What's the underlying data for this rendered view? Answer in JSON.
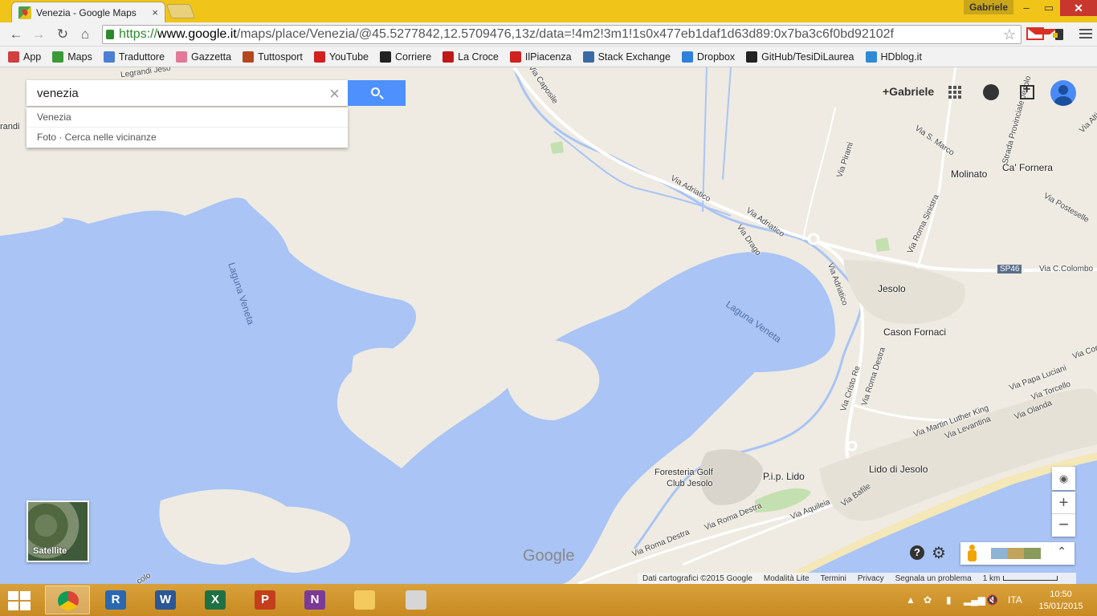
{
  "browser": {
    "tab_title": "Venezia - Google Maps",
    "tab_close": "×",
    "user": "Gabriele",
    "url": {
      "scheme": "https://",
      "host": "www.google.it",
      "path": "/maps/place/Venezia/@45.5277842,12.5709476,13z/data=!4m2!3m1!1s0x477eb1daf1d63d89:0x7ba3c6f0bd92102f"
    },
    "window_controls": {
      "minimize": "–",
      "maximize": "▭",
      "close": "✕"
    }
  },
  "bookmarks": [
    {
      "label": "App",
      "icon": "apps-grid-icon",
      "color": "#d04040"
    },
    {
      "label": "Maps",
      "icon": "maps-icon",
      "color": "#3a9a3a"
    },
    {
      "label": "Traduttore",
      "icon": "translate-icon",
      "color": "#4a7fd4"
    },
    {
      "label": "Gazzetta",
      "icon": "gazzetta-icon",
      "color": "#e2799a"
    },
    {
      "label": "Tuttosport",
      "icon": "tuttosport-icon",
      "color": "#b5471f"
    },
    {
      "label": "YouTube",
      "icon": "youtube-icon",
      "color": "#d32020"
    },
    {
      "label": "Corriere",
      "icon": "corriere-icon",
      "color": "#222222"
    },
    {
      "label": "La Croce",
      "icon": "lacroce-icon",
      "color": "#c01818"
    },
    {
      "label": "IlPiacenza",
      "icon": "ilpiacenza-icon",
      "color": "#d02020"
    },
    {
      "label": "Stack Exchange",
      "icon": "stackexchange-icon",
      "color": "#3a6aa4"
    },
    {
      "label": "Dropbox",
      "icon": "dropbox-icon",
      "color": "#2f7fdc"
    },
    {
      "label": "GitHub/TesiDiLaurea",
      "icon": "github-icon",
      "color": "#222222"
    },
    {
      "label": "HDblog.it",
      "icon": "hdblog-icon",
      "color": "#2f8ad4"
    }
  ],
  "search": {
    "query": "venezia",
    "suggestions": [
      "Venezia",
      "Foto · Cerca nelle vicinanze"
    ]
  },
  "account": {
    "name": "+Gabriele"
  },
  "map": {
    "labels": {
      "laguna1": "Laguna Veneta",
      "laguna2": "Laguna Veneta",
      "jesolo": "Jesolo",
      "molinato": "Molinato",
      "ca_fornera": "Ca' Fornera",
      "cason_fornaci": "Cason Fornaci",
      "lido_jesolo": "Lido di Jesolo",
      "golf1": "Foresteria Golf",
      "golf2": "Club Jesolo",
      "pip_lido": "P.i.p. Lido",
      "grandi": "randi",
      "via_caposile": "Via Caposile",
      "via_adriatico1": "Via Adriatico",
      "via_adriatico2": "Via Adriatico",
      "via_adriatico3": "Via Adriatico",
      "via_drago": "Via Drago",
      "via_pirami": "Via Pirami",
      "via_s_marco": "Via S. Marco",
      "strada_prov": "Strada Provinciale Jesolo",
      "via_roma_sinistra": "Via Roma Sinistra",
      "via_posteselle": "Via Posteselle",
      "sp46": "SP46",
      "via_c_colombo": "Via C.Colombo",
      "via_roma_destra1": "Via Roma Destra",
      "via_roma_destra2": "Via Roma Destra",
      "via_roma_destra3": "Via Roma Destra",
      "via_cristo_re": "Via Cristo Re",
      "via_papa_luciani": "Via Papa Luciani",
      "via_torcello": "Via Torcello",
      "via_olanda": "Via Olanda",
      "via_martin_luther_king": "Via Martin Luther King",
      "via_levantina": "Via Levantina",
      "via_aquileia": "Via Aquileia",
      "via_bafile": "Via Bafile",
      "via_altino": "Via Altino",
      "via_corr": "Via Cor",
      "via_colo": "colo",
      "via_legrandi": "Legrandi Jeso"
    },
    "satellite_label": "Satellite",
    "google_logo": "Google",
    "zoom_in": "+",
    "zoom_out": "−",
    "help": "?",
    "settings_icon": "⚙",
    "expand": "⌃"
  },
  "footer": {
    "data": "Dati cartografici ©2015 Google",
    "lite": "Modalità Lite",
    "terms": "Termini",
    "privacy": "Privacy",
    "report": "Segnala un problema",
    "scale": "1 km"
  },
  "taskbar": {
    "apps": [
      {
        "name": "chrome",
        "label": "",
        "color": "#e0e0e0"
      },
      {
        "name": "r",
        "label": "R",
        "color": "#2a68b0"
      },
      {
        "name": "word",
        "label": "W",
        "color": "#2b5797"
      },
      {
        "name": "excel",
        "label": "X",
        "color": "#1e7145"
      },
      {
        "name": "powerpoint",
        "label": "P",
        "color": "#c43e1c"
      },
      {
        "name": "onenote",
        "label": "N",
        "color": "#7b3a96"
      },
      {
        "name": "explorer",
        "label": "",
        "color": "#f4c95d"
      },
      {
        "name": "snipping",
        "label": "",
        "color": "#d6d6d6"
      }
    ],
    "lang": "ITA",
    "time": "10:50",
    "date": "15/01/2015"
  }
}
